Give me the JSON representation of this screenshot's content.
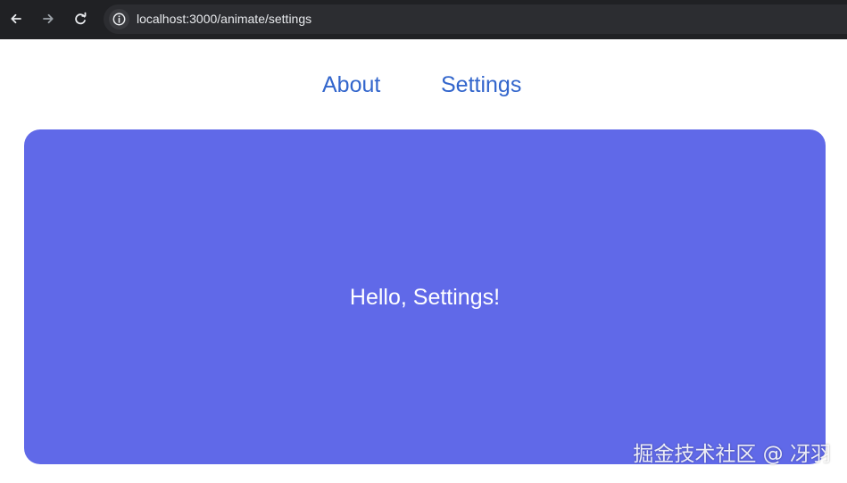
{
  "browser": {
    "url": "localhost:3000/animate/settings",
    "icons": {
      "back": "arrow-left-icon",
      "forward": "arrow-right-icon",
      "reload": "reload-icon",
      "site_info": "info-icon"
    }
  },
  "nav": {
    "links": [
      {
        "label": "About"
      },
      {
        "label": "Settings"
      }
    ]
  },
  "card": {
    "message": "Hello, Settings!",
    "background": "#6069e8"
  },
  "watermark": {
    "text": "掘金技术社区 @ 冴羽"
  },
  "colors": {
    "link": "#3366cc",
    "toolbar": "#202124"
  }
}
